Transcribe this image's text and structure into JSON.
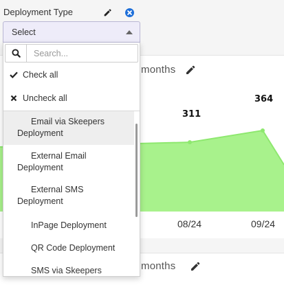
{
  "filter": {
    "label": "Deployment Type",
    "select_value": "Select",
    "search_placeholder": "Search...",
    "check_all_label": "Check all",
    "uncheck_all_label": "Uncheck all",
    "options": [
      "Email via Skeepers Deployment",
      "External Email Deployment",
      "External SMS Deployment",
      "InPage Deployment",
      "QR Code Deployment",
      "SMS via Skeepers"
    ],
    "highlighted_option": "Email via Skeepers Deployment"
  },
  "icons": {
    "edit": "pencil-icon",
    "clear": "close-circle-icon",
    "search": "search-icon",
    "check": "check-icon",
    "uncheck": "x-icon",
    "caret": "caret-up-icon"
  },
  "colors": {
    "accent_blue": "#1e6fd9",
    "select_bg": "#eeecf9",
    "chart_fill": "#a8f28c",
    "chart_line": "#8ee86f"
  },
  "cards": [
    {
      "heading": "months"
    },
    {
      "heading": "months"
    }
  ],
  "chart_data": {
    "type": "area",
    "x": [
      "08/24",
      "09/24"
    ],
    "series": [
      {
        "values": [
          311,
          364
        ]
      }
    ],
    "data_labels": [
      "311",
      "364"
    ],
    "ylim": [
      0,
      700
    ]
  }
}
